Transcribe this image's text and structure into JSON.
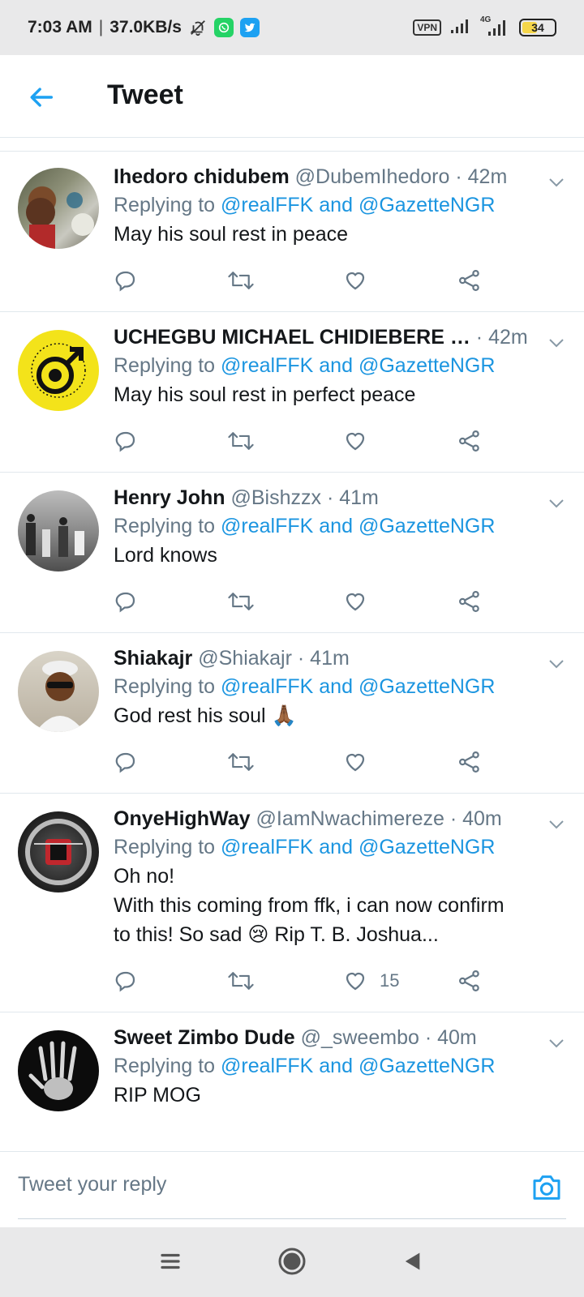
{
  "status_bar": {
    "time": "7:03 AM",
    "separator": "|",
    "speed": "37.0KB/s",
    "vpn_label": "VPN",
    "network_label": "4G",
    "battery": "34"
  },
  "header": {
    "title": "Tweet",
    "back_icon": "arrow-left-icon",
    "accent": "#1da1f2"
  },
  "tweets": [
    {
      "name": "Ihedoro chidubem",
      "handle": "@DubemIhedoro",
      "time": "42m",
      "replying_prefix": "Replying to",
      "mention1": "@realFFK",
      "and": "and",
      "mention2": "@GazetteNGR",
      "text": "May his soul rest in peace",
      "likes": ""
    },
    {
      "name": "UCHEGBU MICHAEL CHIDIEBERE …",
      "handle": "",
      "time": "42m",
      "replying_prefix": "Replying to",
      "mention1": "@realFFK",
      "and": "and",
      "mention2": "@GazetteNGR",
      "text": "May his soul rest in perfect peace",
      "likes": ""
    },
    {
      "name": "Henry John",
      "handle": "@Bishzzx",
      "time": "41m",
      "replying_prefix": "Replying to",
      "mention1": "@realFFK",
      "and": "and",
      "mention2": "@GazetteNGR",
      "text": "Lord knows",
      "likes": ""
    },
    {
      "name": "Shiakajr",
      "handle": "@Shiakajr",
      "time": "41m",
      "replying_prefix": "Replying to",
      "mention1": "@realFFK",
      "and": "and",
      "mention2": "@GazetteNGR",
      "text": "God rest his soul 🙏🏾",
      "likes": ""
    },
    {
      "name": "OnyeHighWay",
      "handle": "@IamNwachimereze",
      "time": "40m",
      "replying_prefix": "Replying to",
      "mention1": "@realFFK",
      "and": "and",
      "mention2": "@GazetteNGR",
      "text_line1": "Oh no!",
      "text_line2": "With this coming from ffk, i can now confirm",
      "text_line3": "to this! So sad 😢 Rip T. B. Joshua...",
      "likes": "15"
    },
    {
      "name": "Sweet Zimbo Dude",
      "handle": "@_sweembo",
      "time": "40m",
      "replying_prefix": "Replying to",
      "mention1": "@realFFK",
      "and": "and",
      "mention2": "@GazetteNGR",
      "text": "RIP MOG",
      "likes": ""
    }
  ],
  "reply": {
    "placeholder": "Tweet your reply",
    "camera_icon": "camera-icon"
  },
  "nav": {
    "menu_icon": "menu-icon",
    "home_icon": "home-circle-icon",
    "back_icon": "back-triangle-icon"
  }
}
